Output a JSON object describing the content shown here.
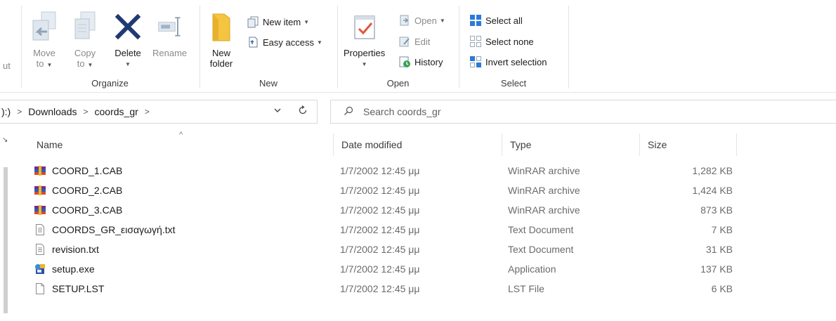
{
  "ribbon": {
    "cut_fragment": "ut",
    "organize": {
      "label": "Organize",
      "move_to": {
        "line1": "Move",
        "line2": "to"
      },
      "copy_to": {
        "line1": "Copy",
        "line2": "to"
      },
      "delete": "Delete",
      "rename": "Rename"
    },
    "new": {
      "label": "New",
      "new_folder": {
        "line1": "New",
        "line2": "folder"
      },
      "new_item": "New item",
      "easy_access": "Easy access"
    },
    "open": {
      "label": "Open",
      "properties": "Properties",
      "open": "Open",
      "edit": "Edit",
      "history": "History"
    },
    "select": {
      "label": "Select",
      "select_all": "Select all",
      "select_none": "Select none",
      "invert_selection": "Invert selection"
    }
  },
  "address": {
    "fragment": "):)",
    "crumbs": [
      "Downloads",
      "coords_gr"
    ]
  },
  "search": {
    "placeholder": "Search coords_gr"
  },
  "columns": {
    "name": "Name",
    "date": "Date modified",
    "type": "Type",
    "size": "Size"
  },
  "files": [
    {
      "name": "COORD_1.CAB",
      "date": "1/7/2002 12:45 μμ",
      "type": "WinRAR archive",
      "size": "1,282 KB",
      "icon": "winrar-archive-icon"
    },
    {
      "name": "COORD_2.CAB",
      "date": "1/7/2002 12:45 μμ",
      "type": "WinRAR archive",
      "size": "1,424 KB",
      "icon": "winrar-archive-icon"
    },
    {
      "name": "COORD_3.CAB",
      "date": "1/7/2002 12:45 μμ",
      "type": "WinRAR archive",
      "size": "873 KB",
      "icon": "winrar-archive-icon"
    },
    {
      "name": "COORDS_GR_εισαγωγή.txt",
      "date": "1/7/2002 12:45 μμ",
      "type": "Text Document",
      "size": "7 KB",
      "icon": "text-file-icon"
    },
    {
      "name": "revision.txt",
      "date": "1/7/2002 12:45 μμ",
      "type": "Text Document",
      "size": "31 KB",
      "icon": "text-file-icon"
    },
    {
      "name": "setup.exe",
      "date": "1/7/2002 12:45 μμ",
      "type": "Application",
      "size": "137 KB",
      "icon": "setup-application-icon"
    },
    {
      "name": "SETUP.LST",
      "date": "1/7/2002 12:45 μμ",
      "type": "LST File",
      "size": "6 KB",
      "icon": "blank-file-icon"
    }
  ]
}
